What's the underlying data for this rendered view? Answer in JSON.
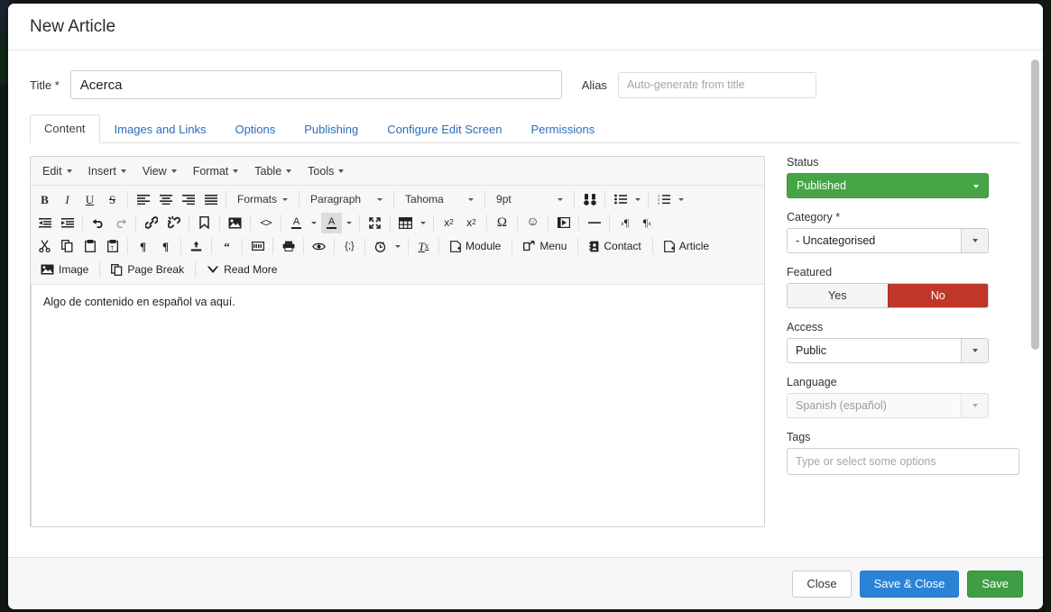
{
  "window": {
    "title": "New Article"
  },
  "form": {
    "title_label": "Title *",
    "title_value": "Acerca",
    "alias_label": "Alias",
    "alias_placeholder": "Auto-generate from title",
    "alias_value": ""
  },
  "tabs": [
    {
      "label": "Content",
      "active": true
    },
    {
      "label": "Images and Links",
      "active": false
    },
    {
      "label": "Options",
      "active": false
    },
    {
      "label": "Publishing",
      "active": false
    },
    {
      "label": "Configure Edit Screen",
      "active": false
    },
    {
      "label": "Permissions",
      "active": false
    }
  ],
  "editor": {
    "menus": [
      "Edit",
      "Insert",
      "View",
      "Format",
      "Table",
      "Tools"
    ],
    "selects": {
      "formats": "Formats",
      "paragraph": "Paragraph",
      "font": "Tahoma",
      "fontsize": "9pt"
    },
    "row2_icons": [
      "bold",
      "italic",
      "underline",
      "strikethrough",
      "align-left",
      "align-center",
      "align-right",
      "align-justify"
    ],
    "row3_icons": [
      "outdent",
      "indent",
      "undo",
      "redo",
      "link",
      "unlink",
      "anchor",
      "image",
      "source-code",
      "text-color",
      "background-color",
      "fullscreen",
      "table",
      "subscript",
      "superscript",
      "special-character",
      "emoticon",
      "media",
      "horizontal-rule",
      "ltr",
      "rtl"
    ],
    "row4_icons": [
      "cut",
      "copy",
      "paste",
      "paste-as-text",
      "show-blocks",
      "visual-chars",
      "insert-template",
      "blockquote",
      "nonbreaking",
      "print",
      "preview",
      "code-sample",
      "insert-datetime",
      "remove-format"
    ],
    "row4_buttons": [
      "Module",
      "Menu",
      "Contact",
      "Article"
    ],
    "row5_buttons": [
      "Image",
      "Page Break",
      "Read More"
    ],
    "content": "Algo de contenido en español va aquí."
  },
  "sidebar": {
    "status": {
      "label": "Status",
      "value": "Published"
    },
    "category": {
      "label": "Category *",
      "value": "- Uncategorised"
    },
    "featured": {
      "label": "Featured",
      "yes": "Yes",
      "no": "No",
      "selected": "No"
    },
    "access": {
      "label": "Access",
      "value": "Public"
    },
    "language": {
      "label": "Language",
      "value": "Spanish (español)"
    },
    "tags": {
      "label": "Tags",
      "placeholder": "Type or select some options",
      "value": ""
    }
  },
  "footer": {
    "close": "Close",
    "save_close": "Save & Close",
    "save": "Save"
  },
  "colors": {
    "status_green": "#45a545",
    "featured_red": "#c0372a",
    "primary_blue": "#2a83d6",
    "save_green": "#3f9e43",
    "tab_link": "#2a6ebb"
  }
}
